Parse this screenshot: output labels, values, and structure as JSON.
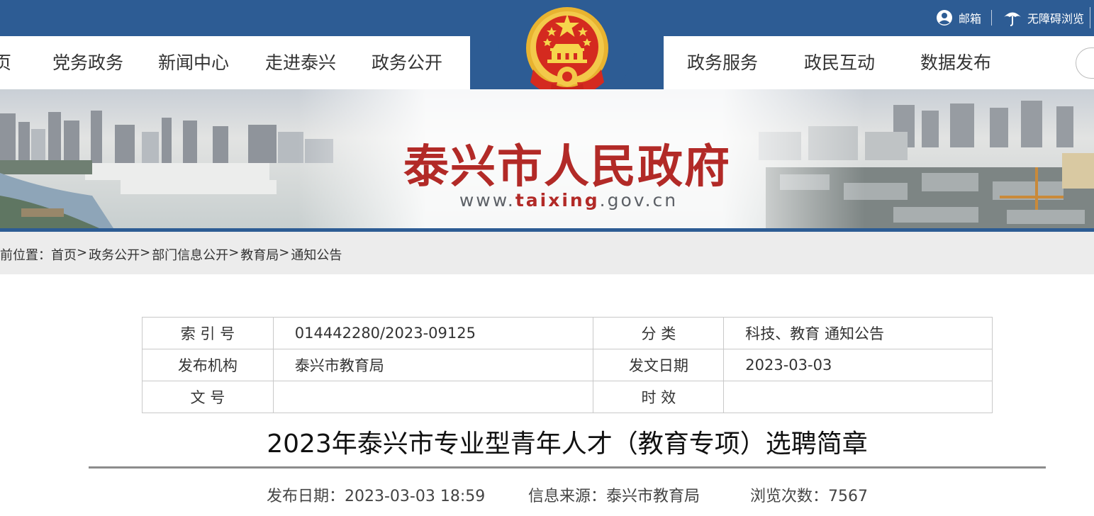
{
  "header": {
    "links": [
      {
        "label": "邮箱",
        "icon": "user-icon"
      },
      {
        "label": "无障碍浏览",
        "icon": "umbrella-icon"
      }
    ]
  },
  "nav": {
    "left": [
      "页",
      "党务政务",
      "新闻中心",
      "走进泰兴",
      "政务公开"
    ],
    "right": [
      "政务服务",
      "政民互动",
      "数据发布"
    ]
  },
  "banner": {
    "title": "泰兴市人民政府",
    "url_prefix": "www.",
    "url_highlight": "taixing",
    "url_suffix": ".gov.cn"
  },
  "breadcrumb": {
    "prefix": "前位置：",
    "items": [
      "首页",
      "政务公开",
      "部门信息公开",
      "教育局",
      "通知公告"
    ]
  },
  "meta_table": {
    "rows": [
      [
        "索 引 号",
        "014442280/2023-09125",
        "分 类",
        "科技、教育 通知公告"
      ],
      [
        "发布机构",
        "泰兴市教育局",
        "发文日期",
        "2023-03-03"
      ],
      [
        "文 号",
        "",
        "时 效",
        ""
      ]
    ]
  },
  "article": {
    "title": "2023年泰兴市专业型青年人才（教育专项）选聘简章",
    "publish_date": "发布日期：2023-03-03 18:59",
    "source": "信息来源：泰兴市教育局",
    "views": "浏览次数：7567"
  },
  "colors": {
    "primary_blue": "#2d5c94",
    "banner_red": "#b22a27",
    "breadcrumb_bg": "#ececec"
  }
}
